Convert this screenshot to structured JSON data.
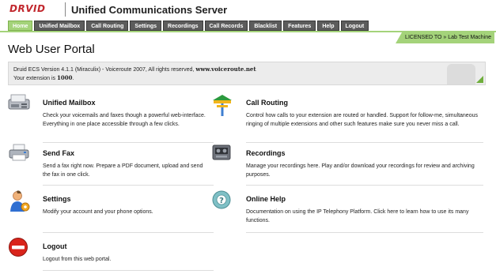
{
  "header": {
    "logo_text": "DRVID",
    "app_title": "Unified Communications Server"
  },
  "nav": {
    "items": [
      {
        "label": "Home",
        "active": true
      },
      {
        "label": "Unified Mailbox"
      },
      {
        "label": "Call Routing"
      },
      {
        "label": "Settings"
      },
      {
        "label": "Recordings"
      },
      {
        "label": "Call Records"
      },
      {
        "label": "Blacklist"
      },
      {
        "label": "Features"
      },
      {
        "label": "Help"
      },
      {
        "label": "Logout"
      }
    ]
  },
  "license": "LICENSED TO » Lab Test Machine",
  "page_title": "Web User Portal",
  "info": {
    "version_prefix": "Druid ECS Version 4.1.1 (Miraculix) - Voiceroute 2007, All rights reserved, ",
    "site": "www.voiceroute.net",
    "ext_prefix": "Your extension is ",
    "extension": "1000",
    "ext_suffix": "."
  },
  "tiles": {
    "mailbox": {
      "title": "Unified Mailbox",
      "desc": "Check your voicemails and faxes though a powerful web-interface. Everything in one place accessible through a few clicks.",
      "icon": "fax-machine-icon"
    },
    "routing": {
      "title": "Call Routing",
      "desc": "Control how calls to your extension are routed or handled. Support for follow-me, simultaneous ringing of multiple extensions and other such features make sure you never miss a call.",
      "icon": "signpost-icon"
    },
    "fax": {
      "title": "Send Fax",
      "desc": "Send a fax right now. Prepare a PDF document, upload and send the fax in one click.",
      "icon": "printer-icon"
    },
    "recordings": {
      "title": "Recordings",
      "desc": "Manage your recordings here. Play and/or download your recordings for review and archiving purposes.",
      "icon": "recorder-icon"
    },
    "settings": {
      "title": "Settings",
      "desc": "Modify your account and your phone options.",
      "icon": "user-settings-icon"
    },
    "help": {
      "title": "Online Help",
      "desc": "Documentation on using the IP Telephony Platform. Click here to learn how to use its many functions.",
      "icon": "help-lifebuoy-icon"
    },
    "logout": {
      "title": "Logout",
      "desc": "Logout from this web portal.",
      "icon": "stop-icon"
    }
  },
  "colors": {
    "accent_green": "#a4d37a",
    "nav_bg": "#5c5c5c",
    "logo_red": "#c1272d"
  }
}
